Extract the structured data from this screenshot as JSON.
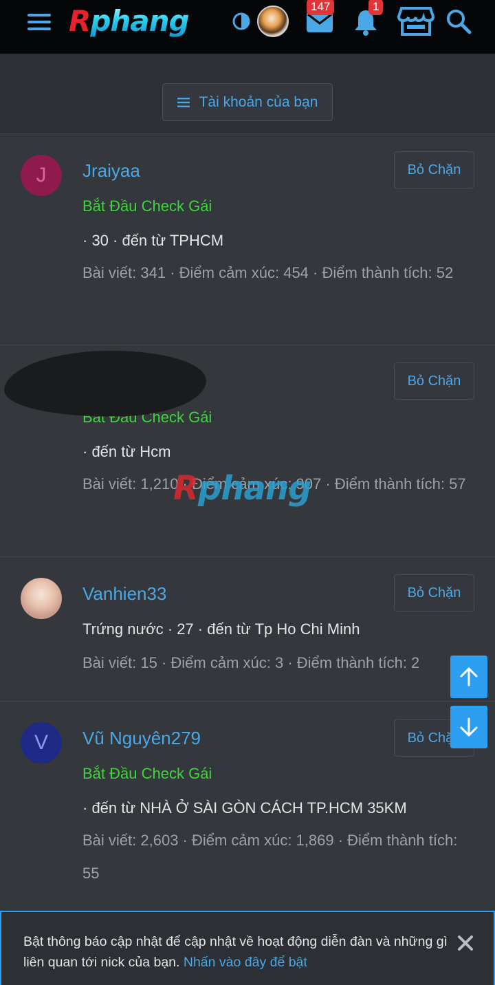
{
  "header": {
    "logo_first": "R",
    "logo_rest": "phang",
    "mail_badge": "147",
    "bell_badge": "1",
    "icons": [
      "menu-icon",
      "theme-toggle-icon",
      "avatar",
      "mail-icon",
      "bell-icon",
      "store-icon",
      "search-icon"
    ]
  },
  "account_button": {
    "label": "Tài khoản của bạn"
  },
  "members": [
    {
      "avatar_letter": "J",
      "avatar_color": "#8e1b4c",
      "name": "Jraiyaa",
      "title": "Bắt Đầu Check Gái",
      "info": "· 30 · đến từ TPHCM",
      "stats": "Bài viết: 341 · Điểm cảm xúc: 454 · Điểm thành tích: 52",
      "button": "Bỏ Chặn"
    },
    {
      "title": "Bắt Đầu Check Gái",
      "info": "· đến từ Hcm",
      "stats": "Bài viết: 1,210 · Điểm cảm xúc: 907 · Điểm thành tích: 57",
      "button": "Bỏ Chặn"
    },
    {
      "name": "Vanhien33",
      "info": "Trứng nước · 27 · đến từ Tp Ho Chi Minh",
      "stats": "Bài viết: 15 · Điểm cảm xúc: 3 · Điểm thành tích: 2",
      "button": "Bỏ Chặn"
    },
    {
      "avatar_letter": "V",
      "avatar_color": "#1f2a86",
      "name": "Vũ Nguyên279",
      "title": "Bắt Đầu Check Gái",
      "info": "· đến từ NHÀ Ở SÀI GÒN CÁCH TP.HCM 35KM",
      "stats": "Bài viết: 2,603 · Điểm cảm xúc: 1,869 · Điểm thành tích: 55",
      "button": "Bỏ Chặn"
    }
  ],
  "watermark": {
    "first": "R",
    "rest": "phang"
  },
  "notice": {
    "text": "Bật thông báo cập nhật để cập nhật về hoạt động diễn đàn và những gì liên quan tới nick của bạn. ",
    "link": "Nhấn vào đây để bật"
  },
  "colors": {
    "accent": "#4aa8e6",
    "title_green": "#3dd63a",
    "scroll_button": "#2e9ef0"
  }
}
